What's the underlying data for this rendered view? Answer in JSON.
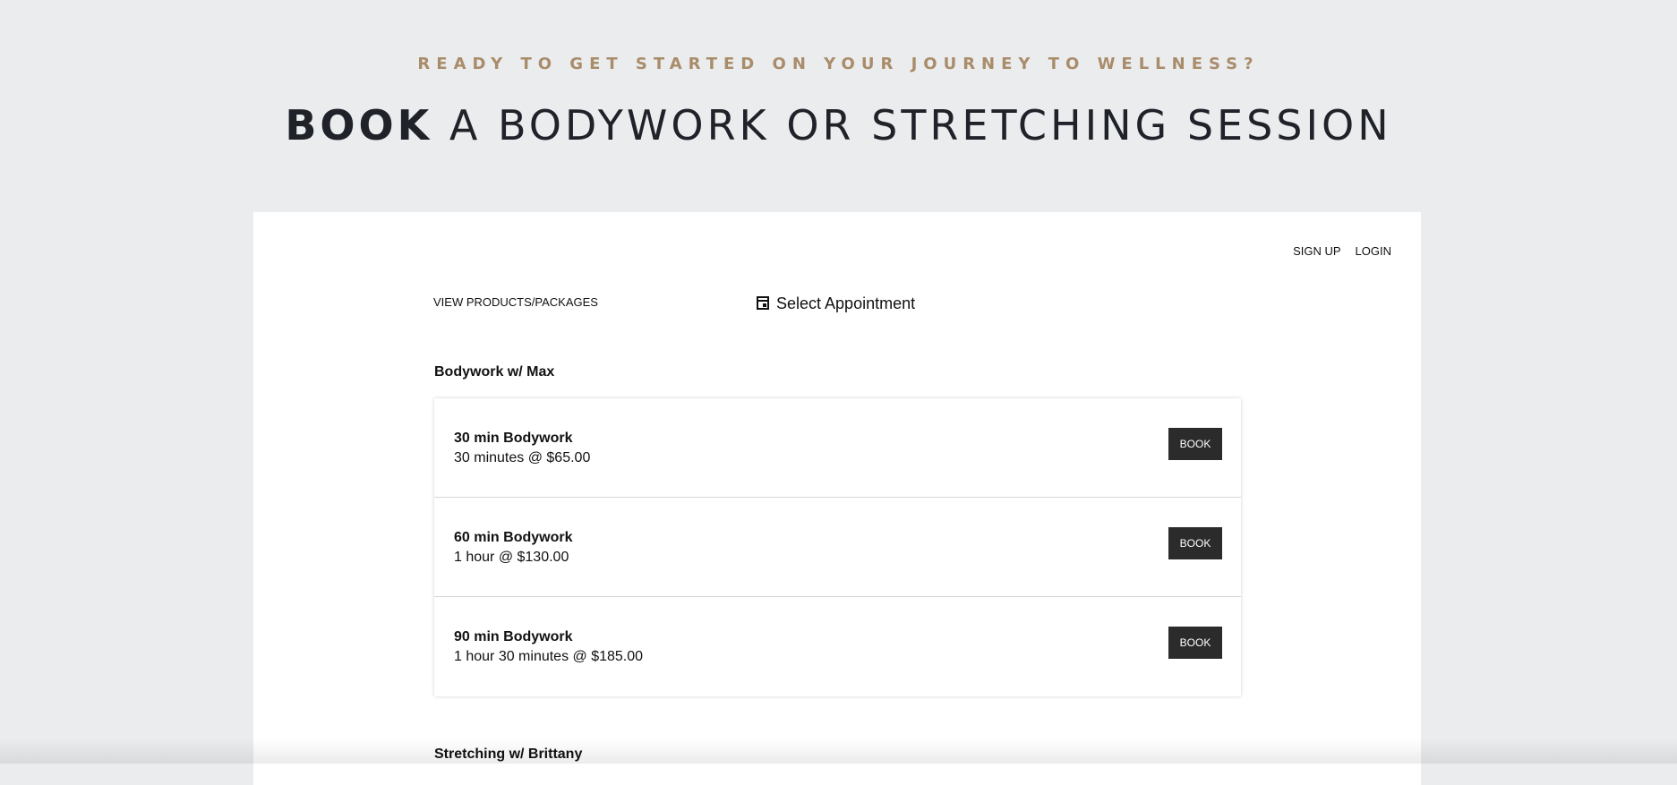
{
  "hero": {
    "eyebrow": "READY TO GET STARTED ON YOUR JOURNEY TO WELLNESS?",
    "headline_strong": "BOOK",
    "headline_rest": " A BODYWORK OR STRETCHING SESSION"
  },
  "auth": {
    "signup": "SIGN UP",
    "login": "LOGIN"
  },
  "nav": {
    "view_products": "VIEW PRODUCTS/PACKAGES",
    "select_appointment": "Select Appointment"
  },
  "groups": [
    {
      "title": "Bodywork w/ Max",
      "items": [
        {
          "name": "30 min Bodywork",
          "detail": "30 minutes @ $65.00",
          "button": "BOOK"
        },
        {
          "name": "60 min Bodywork",
          "detail": "1 hour @ $130.00",
          "button": "BOOK"
        },
        {
          "name": "90 min Bodywork",
          "detail": "1 hour 30 minutes @ $185.00",
          "button": "BOOK"
        }
      ]
    },
    {
      "title": "Stretching w/ Brittany",
      "items": []
    }
  ],
  "colors": {
    "accent": "#a98c6a",
    "background": "#ebecee",
    "button": "#2b2b2b"
  },
  "icons": {
    "select_appointment": "calendar-icon"
  }
}
